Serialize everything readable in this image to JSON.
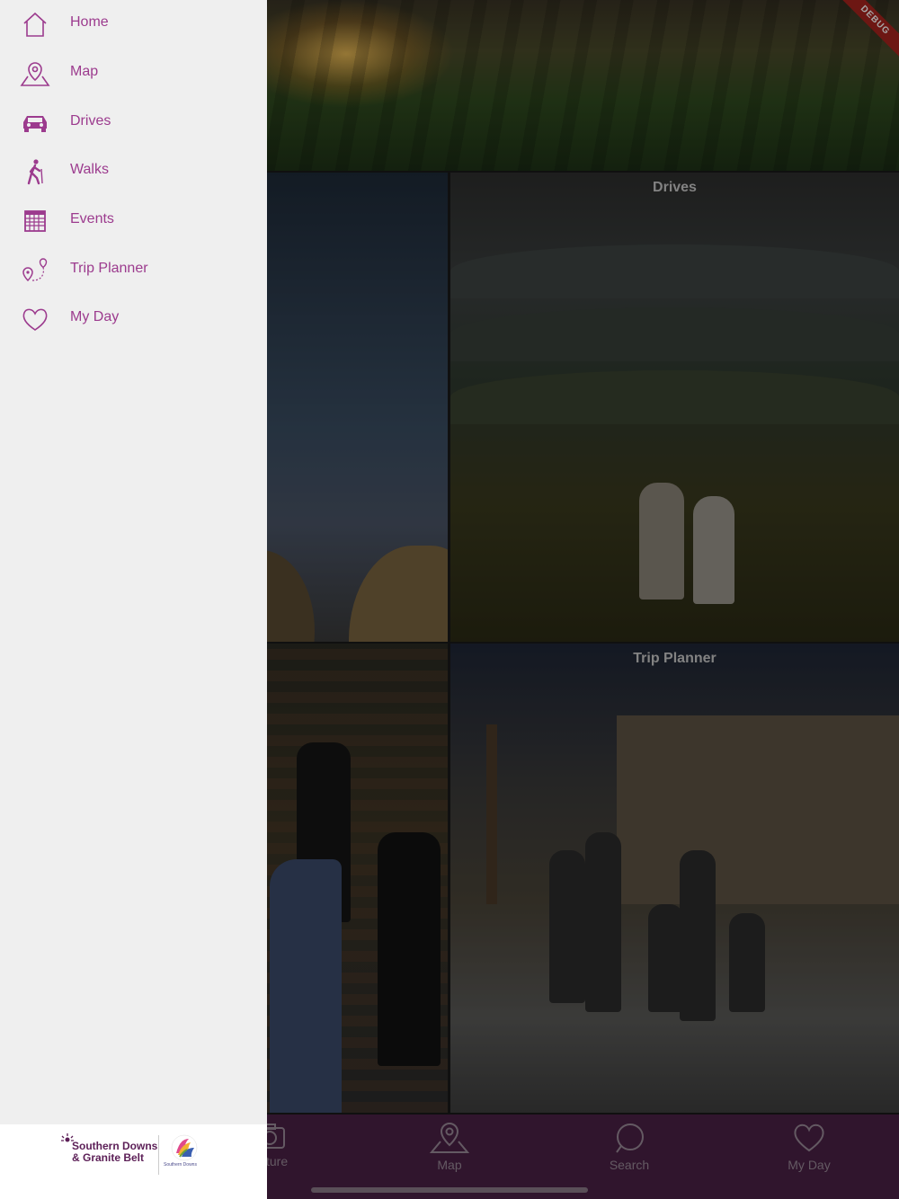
{
  "tiles": {
    "drives_title": "Drives",
    "trip_planner_title": "Trip Planner"
  },
  "tab_bar": {
    "items": [
      {
        "label": "ture",
        "icon": "camera-icon"
      },
      {
        "label": "Map",
        "icon": "map-pin-icon"
      },
      {
        "label": "Search",
        "icon": "search-icon"
      },
      {
        "label": "My Day",
        "icon": "heart-icon"
      }
    ]
  },
  "debug_banner": "DEBUG",
  "drawer": {
    "items": [
      {
        "label": "Home",
        "icon": "home-icon"
      },
      {
        "label": "Map",
        "icon": "map-icon"
      },
      {
        "label": "Drives",
        "icon": "car-icon"
      },
      {
        "label": "Walks",
        "icon": "walker-icon"
      },
      {
        "label": "Events",
        "icon": "calendar-icon"
      },
      {
        "label": "Trip Planner",
        "icon": "route-icon"
      },
      {
        "label": "My Day",
        "icon": "heart-icon"
      }
    ],
    "footer": {
      "logo_line1": "Southern Downs",
      "logo_line2": "& Granite Belt",
      "council_text": "Southern Downs"
    }
  },
  "colors": {
    "drawer_bg": "#efefef",
    "menu_accent": "#9c3b8e",
    "tab_bar_bg": "#4b2146"
  }
}
